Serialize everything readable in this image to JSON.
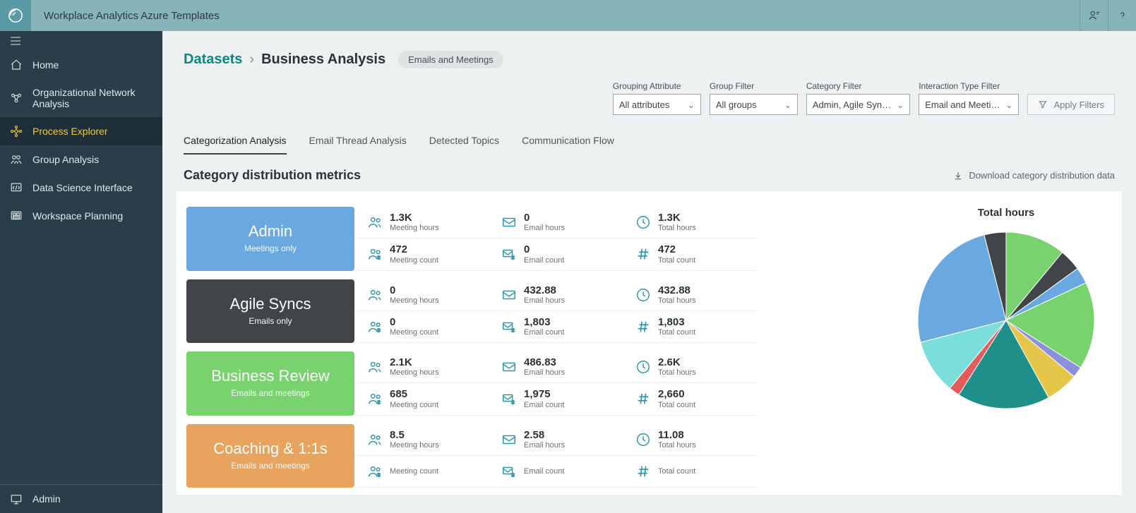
{
  "header": {
    "app_title": "Workplace Analytics Azure Templates"
  },
  "sidebar": {
    "items": [
      {
        "label": "Home"
      },
      {
        "label": "Organizational Network Analysis"
      },
      {
        "label": "Process Explorer"
      },
      {
        "label": "Group Analysis"
      },
      {
        "label": "Data Science Interface"
      },
      {
        "label": "Workspace Planning"
      }
    ],
    "footer_label": "Admin"
  },
  "breadcrumb": {
    "root": "Datasets",
    "sep": "›",
    "current": "Business Analysis",
    "pill": "Emails and Meetings"
  },
  "filters": {
    "grouping": {
      "label": "Grouping Attribute",
      "value": "All attributes"
    },
    "group": {
      "label": "Group Filter",
      "value": "All groups"
    },
    "category": {
      "label": "Category Filter",
      "value": "Admin, Agile Syn…"
    },
    "interaction": {
      "label": "Interaction Type Filter",
      "value": "Email and Meeti…"
    },
    "apply": "Apply Filters"
  },
  "tabs": [
    {
      "label": "Categorization Analysis"
    },
    {
      "label": "Email Thread Analysis"
    },
    {
      "label": "Detected Topics"
    },
    {
      "label": "Communication Flow"
    }
  ],
  "section": {
    "title": "Category distribution metrics",
    "download": "Download category distribution data"
  },
  "categories": [
    {
      "name": "Admin",
      "sub": "Meetings only",
      "color": "#6aa9e0",
      "meeting_hours": "1.3K",
      "meeting_count": "472",
      "email_hours": "0",
      "email_count": "0",
      "total_hours": "1.3K",
      "total_count": "472"
    },
    {
      "name": "Agile Syncs",
      "sub": "Emails only",
      "color": "#414549",
      "meeting_hours": "0",
      "meeting_count": "0",
      "email_hours": "432.88",
      "email_count": "1,803",
      "total_hours": "432.88",
      "total_count": "1,803"
    },
    {
      "name": "Business Review",
      "sub": "Emails and meetings",
      "color": "#78d26e",
      "meeting_hours": "2.1K",
      "meeting_count": "685",
      "email_hours": "486.83",
      "email_count": "1,975",
      "total_hours": "2.6K",
      "total_count": "2,660"
    },
    {
      "name": "Coaching & 1:1s",
      "sub": "Emails and meetings",
      "color": "#e8a35e",
      "meeting_hours": "8.5",
      "meeting_count": "",
      "email_hours": "2.58",
      "email_count": "",
      "total_hours": "11.08",
      "total_count": ""
    }
  ],
  "metric_labels": {
    "meeting_hours": "Meeting hours",
    "meeting_count": "Meeting count",
    "email_hours": "Email hours",
    "email_count": "Email count",
    "total_hours": "Total hours",
    "total_count": "Total count"
  },
  "chart": {
    "title": "Total hours"
  },
  "chart_data": {
    "type": "pie",
    "title": "Total hours",
    "series": [
      {
        "name": "Slice 1",
        "value": 11,
        "color": "#78d26e"
      },
      {
        "name": "Slice 2",
        "value": 4,
        "color": "#414549"
      },
      {
        "name": "Slice 3",
        "value": 3,
        "color": "#6aa9e0"
      },
      {
        "name": "Slice 4",
        "value": 16,
        "color": "#78d26e"
      },
      {
        "name": "Slice 5",
        "value": 2,
        "color": "#8b8fdc"
      },
      {
        "name": "Slice 6",
        "value": 6,
        "color": "#e5c648"
      },
      {
        "name": "Slice 7",
        "value": 17,
        "color": "#1f8f8a"
      },
      {
        "name": "Slice 8",
        "value": 2,
        "color": "#e55b5b"
      },
      {
        "name": "Slice 9",
        "value": 10,
        "color": "#7bdedb"
      },
      {
        "name": "Slice 10",
        "value": 25,
        "color": "#6aa9e0"
      },
      {
        "name": "Slice 11",
        "value": 4,
        "color": "#414549"
      }
    ]
  }
}
